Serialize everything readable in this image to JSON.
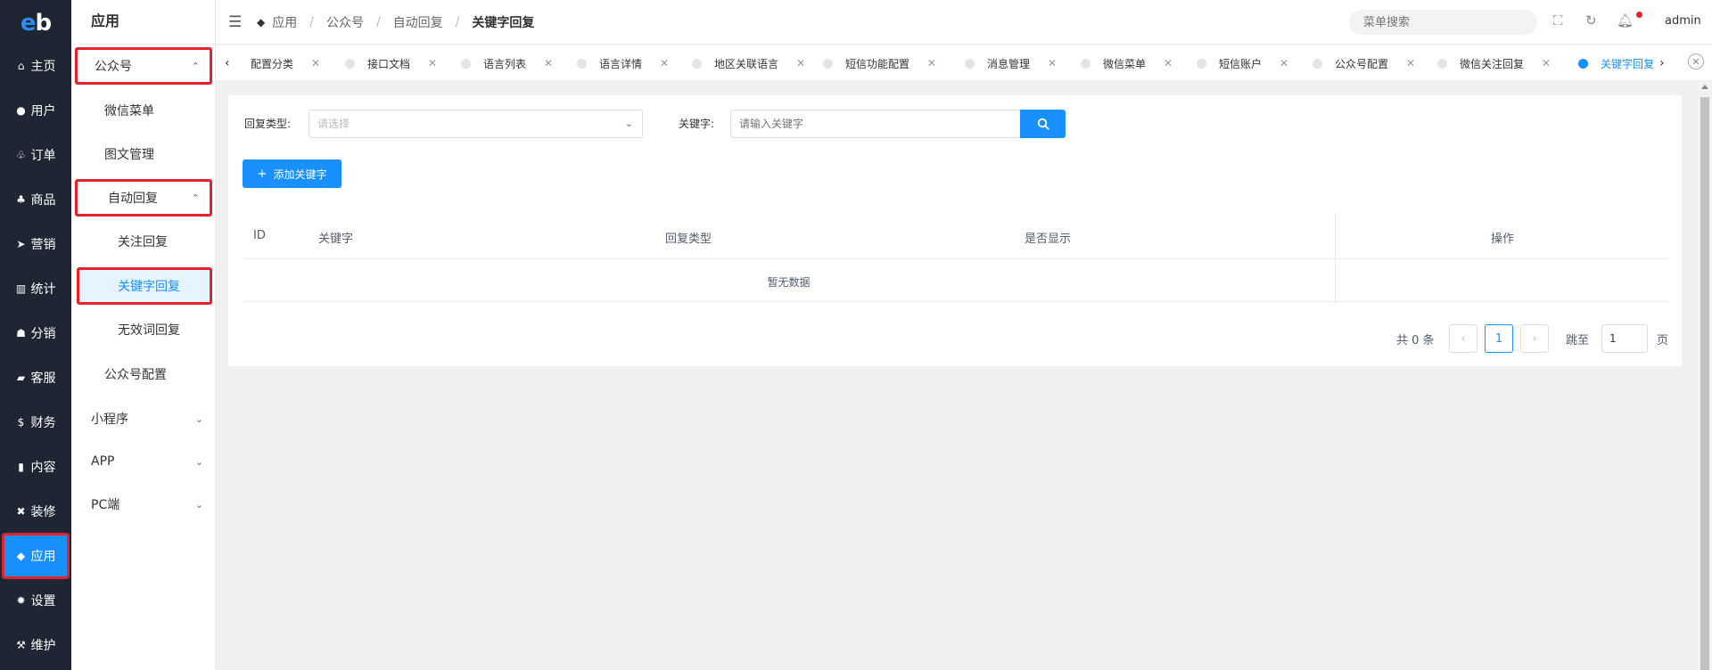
{
  "rail": {
    "logo_e": "e",
    "logo_b": "b",
    "items": [
      {
        "label": "主页",
        "icon": "home-icon",
        "glyph": "⌂"
      },
      {
        "label": "用户",
        "icon": "user-icon",
        "glyph": "●"
      },
      {
        "label": "订单",
        "icon": "cart-icon",
        "glyph": "♧"
      },
      {
        "label": "商品",
        "icon": "basket-icon",
        "glyph": "♣"
      },
      {
        "label": "营销",
        "icon": "send-icon",
        "glyph": "➤"
      },
      {
        "label": "统计",
        "icon": "bar-chart-icon",
        "glyph": "▥"
      },
      {
        "label": "分销",
        "icon": "group-icon",
        "glyph": "☗"
      },
      {
        "label": "客服",
        "icon": "chat-icon",
        "glyph": "▰"
      },
      {
        "label": "财务",
        "icon": "dollar-icon",
        "glyph": "$"
      },
      {
        "label": "内容",
        "icon": "book-icon",
        "glyph": "▮"
      },
      {
        "label": "装修",
        "icon": "tools-icon",
        "glyph": "✖"
      },
      {
        "label": "应用",
        "icon": "cube-icon",
        "glyph": "◆"
      },
      {
        "label": "设置",
        "icon": "gear-icon",
        "glyph": "✹"
      },
      {
        "label": "维护",
        "icon": "hammer-icon",
        "glyph": "⚒"
      }
    ]
  },
  "submenu": {
    "title": "应用",
    "items": [
      {
        "label": "公众号",
        "chev": "⌃"
      },
      {
        "label": "微信菜单"
      },
      {
        "label": "图文管理"
      },
      {
        "label": "自动回复",
        "chev": "⌃"
      },
      {
        "label": "关注回复"
      },
      {
        "label": "关键字回复"
      },
      {
        "label": "无效词回复"
      },
      {
        "label": "公众号配置"
      },
      {
        "label": "小程序",
        "chev": "⌄"
      },
      {
        "label": "APP",
        "chev": "⌄"
      },
      {
        "label": "PC端",
        "chev": "⌄"
      }
    ]
  },
  "header": {
    "breadcrumbs": [
      "应用",
      "公众号",
      "自动回复",
      "关键字回复"
    ],
    "search_placeholder": "菜单搜索",
    "user": "admin"
  },
  "tabs": {
    "items": [
      "配置分类",
      "接口文档",
      "语言列表",
      "语言详情",
      "地区关联语言",
      "短信功能配置",
      "消息管理",
      "微信菜单",
      "短信账户",
      "公众号配置",
      "微信关注回复",
      "关键字回复"
    ],
    "active_index": 11
  },
  "filters": {
    "reply_type_label": "回复类型:",
    "reply_type_placeholder": "请选择",
    "keyword_label": "关键字:",
    "keyword_placeholder": "请输入关键字"
  },
  "actions": {
    "add_keyword": "添加关键字"
  },
  "table": {
    "columns": [
      "ID",
      "关键字",
      "回复类型",
      "是否显示",
      "操作"
    ],
    "empty_text": "暂无数据"
  },
  "pagination": {
    "total_text": "共 0 条",
    "current_page": "1",
    "jump_label": "跳至",
    "jump_value": "1",
    "page_suffix": "页"
  },
  "colors": {
    "primary": "#1890ff",
    "sidebar_bg": "#1f2633",
    "highlight_border": "#e8202a"
  }
}
